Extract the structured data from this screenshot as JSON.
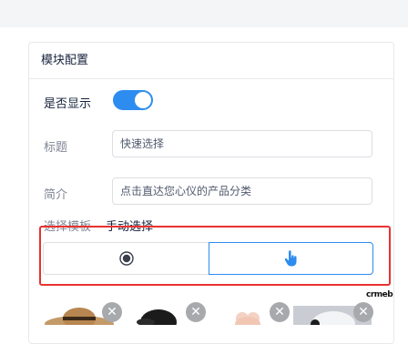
{
  "card": {
    "title": "模块配置"
  },
  "show": {
    "label": "是否显示",
    "enabled": true
  },
  "title_field": {
    "label": "标题",
    "value": "快速选择"
  },
  "intro_field": {
    "label": "简介",
    "value": "点击直达您心仪的产品分类"
  },
  "template": {
    "label": "选择模板",
    "value": "手动选择",
    "options": [
      {
        "icon": "radio-icon",
        "selected": false
      },
      {
        "icon": "pointer-hand-icon",
        "selected": true
      }
    ]
  },
  "brand": {
    "text": "crmeb"
  },
  "colors": {
    "accent": "#2d8cf0",
    "highlight": "#e8322f",
    "delete_badge": "#a7a9ad"
  },
  "images": [
    {
      "name": "straw-hat",
      "delete_icon": "close-icon"
    },
    {
      "name": "black-cap",
      "delete_icon": "close-icon"
    },
    {
      "name": "plush-toy",
      "delete_icon": "close-icon"
    },
    {
      "name": "white-cap",
      "delete_icon": "close-icon"
    }
  ]
}
